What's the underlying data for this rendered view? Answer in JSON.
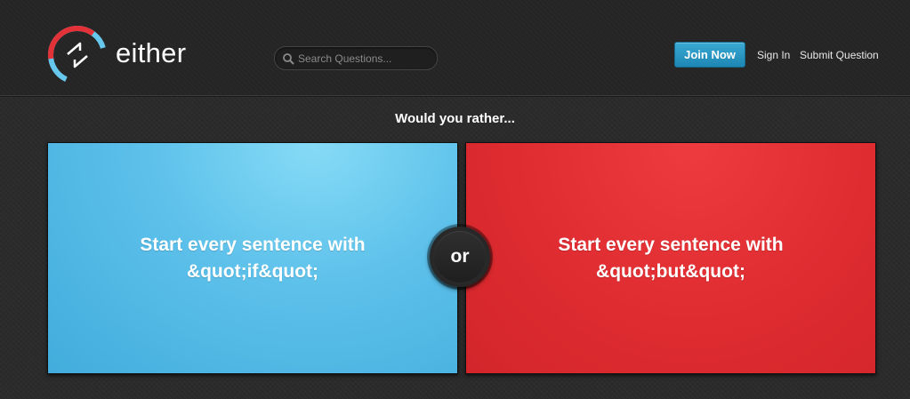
{
  "brand": {
    "name": "either",
    "colors": {
      "blue": "#5cc6ee",
      "red": "#e23237",
      "join_button": "#2196c6"
    }
  },
  "header": {
    "search": {
      "placeholder": "Search Questions...",
      "value": ""
    },
    "join_label": "Join Now",
    "sign_in_label": "Sign In",
    "submit_label": "Submit Question"
  },
  "question": {
    "prompt": "Would you rather...",
    "option_a": "Start every sentence with &quot;if&quot;",
    "option_b": "Start every sentence with &quot;but&quot;",
    "divider": "or"
  },
  "icons": {
    "logo": "either-swap-arrows-icon",
    "search": "magnifier-icon"
  }
}
